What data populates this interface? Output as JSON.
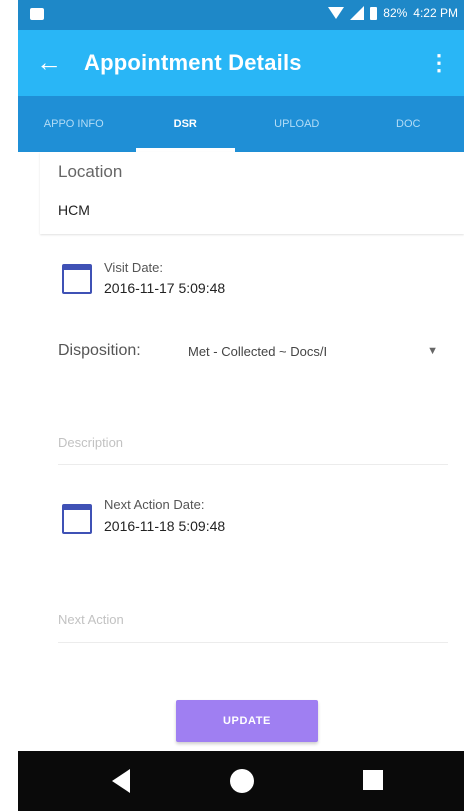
{
  "status_bar": {
    "battery": "82%",
    "time": "4:22 PM"
  },
  "app_bar": {
    "title": "Appointment Details",
    "back_icon": "arrow-left-icon",
    "menu_icon": "more-vert-icon"
  },
  "tabs": [
    {
      "label": "APPO INFO"
    },
    {
      "label": "DSR"
    },
    {
      "label": "UPLOAD"
    },
    {
      "label": "DOC"
    }
  ],
  "active_tab": "DSR",
  "location": {
    "label": "Location",
    "value": "HCM"
  },
  "visit_date": {
    "label": "Visit Date:",
    "value": "2016-11-17 5:09:48"
  },
  "disposition": {
    "label": "Disposition:",
    "value": "Met - Collected ~ Docs/I"
  },
  "description": {
    "placeholder": "Description"
  },
  "next_action_date": {
    "label": "Next Action Date:",
    "value": "2016-11-18 5:09:48"
  },
  "next_action": {
    "placeholder": "Next Action"
  },
  "update_button": {
    "label": "UPDATE"
  },
  "colors": {
    "primary": "#29b6f6",
    "tab_bar": "#1f8fd6",
    "accent": "#9f7ff2",
    "calendar_icon": "#3f51b5"
  }
}
